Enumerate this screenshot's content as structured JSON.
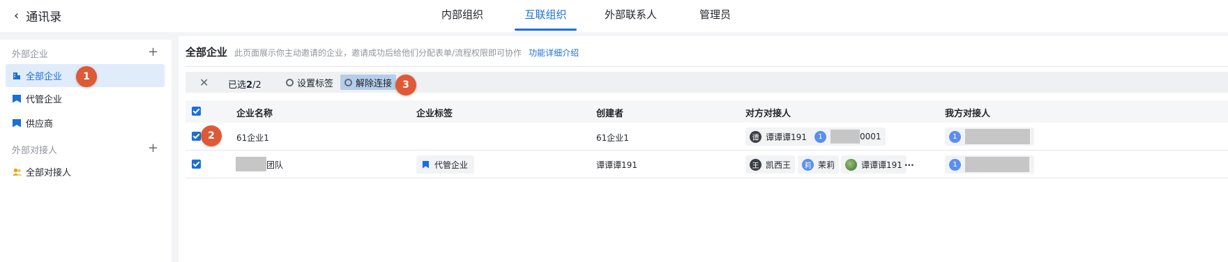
{
  "header": {
    "back_label": "通讯录",
    "tabs": [
      "内部组织",
      "互联组织",
      "外部联系人",
      "管理员"
    ],
    "active_tab": "互联组织"
  },
  "sidebar": {
    "group1": "外部企业",
    "items": [
      "全部企业",
      "代管企业",
      "供应商"
    ],
    "group2": "外部对接人",
    "contact_item": "全部对接人"
  },
  "main": {
    "title": "全部企业",
    "desc": "此页面展示你主动邀请的企业，邀请成功后给他们分配表单/流程权限即可协作",
    "link": "功能详细介绍"
  },
  "toolbar": {
    "selected_prefix": "已选",
    "selected_count": "2",
    "selected_total": "/2",
    "set_tag": "设置标签",
    "disconnect": "解除连接"
  },
  "table": {
    "headers": [
      "企业名称",
      "企业标签",
      "创建者",
      "对方对接人",
      "我方对接人"
    ],
    "rows": [
      {
        "name": "61企业1",
        "tag": "",
        "creator": "61企业1",
        "peer_contacts": [
          {
            "avatar": "谭",
            "name": "谭谭谭191"
          },
          {
            "avatar": "1",
            "name": "0001"
          }
        ],
        "our_contacts": [
          {
            "avatar": "1"
          }
        ]
      },
      {
        "name": "团队",
        "tag": "代管企业",
        "creator": "谭谭谭191",
        "peer_contacts": [
          {
            "avatar": "王",
            "name": "凯西王"
          },
          {
            "avatar": "莉",
            "name": "茉莉"
          },
          {
            "avatar": "",
            "name": "谭谭谭191"
          }
        ],
        "more": "...",
        "our_contacts": [
          {
            "avatar": "1"
          }
        ]
      }
    ]
  },
  "markers": [
    "1",
    "2",
    "3"
  ],
  "colors": {
    "accent": "#1a6fd8",
    "marker": "#de5a36",
    "highlight": "#b4cde9"
  }
}
